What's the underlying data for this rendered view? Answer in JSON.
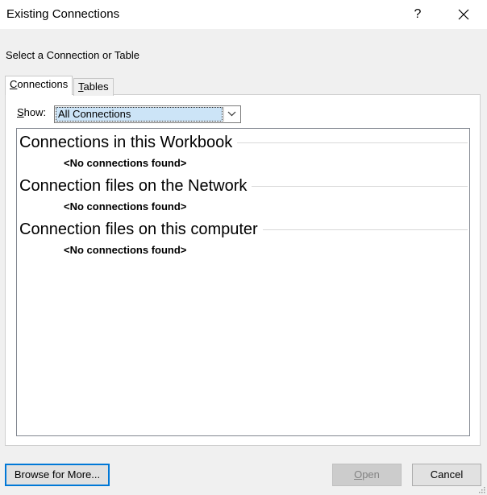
{
  "window": {
    "title": "Existing Connections",
    "help_label": "?",
    "close_icon": "close-icon"
  },
  "prompt": "Select a Connection or Table",
  "tabs": [
    {
      "label": "Connections",
      "access_key": "C",
      "rest": "onnections",
      "active": true
    },
    {
      "label": "Tables",
      "access_key": "T",
      "rest": "ables",
      "active": false
    }
  ],
  "show": {
    "label_key": "S",
    "label_rest": "how:",
    "selected": "All Connections",
    "dropdown_icon": "chevron-down-icon"
  },
  "groups": [
    {
      "header": "Connections in this Workbook",
      "empty": "<No connections found>"
    },
    {
      "header": "Connection files on the Network",
      "empty": "<No connections found>"
    },
    {
      "header": "Connection files on this computer",
      "empty": "<No connections found>"
    }
  ],
  "buttons": {
    "browse": "Browse for More...",
    "open_key": "O",
    "open_rest": "pen",
    "cancel": "Cancel"
  },
  "colors": {
    "selection": "#cce4f7",
    "focus_border": "#0078d7"
  }
}
